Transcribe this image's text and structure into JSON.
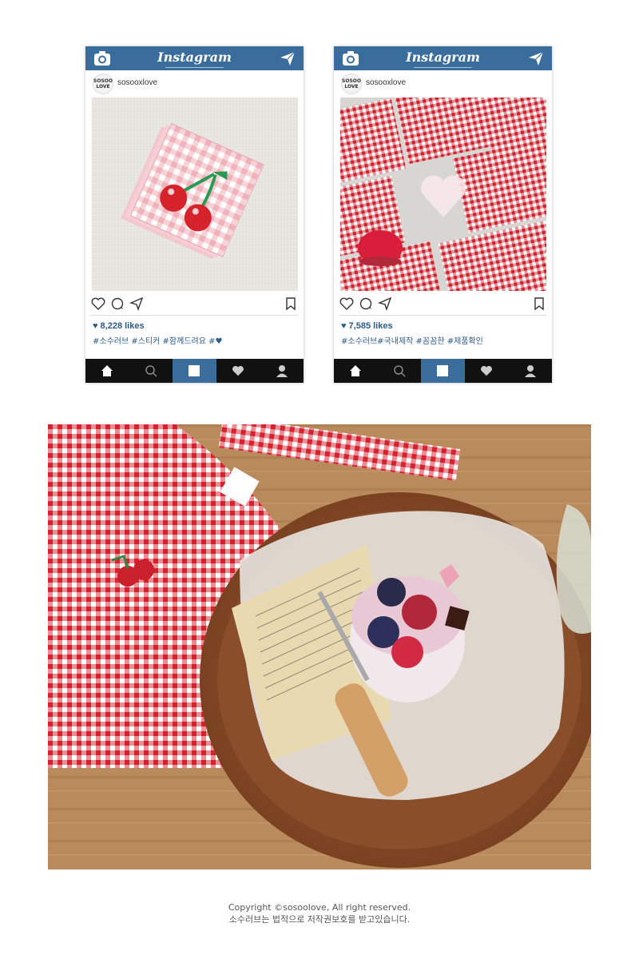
{
  "posts": [
    {
      "app_title": "Instagram",
      "avatar_text": "SOSOO LOVE",
      "username": "sosooxlove",
      "likes": "8,228 likes",
      "tags": "#소수러브  #스티커 #함께드려요 #♥"
    },
    {
      "app_title": "Instagram",
      "avatar_text": "SOSOO LOVE",
      "username": "sosooxlove",
      "likes": "7,585 likes",
      "tags": "#소수러브#국내제작  #꼼꼼한  #제품확인"
    }
  ],
  "footer": {
    "line1": "Copyright ©sosoolove, All right reserved.",
    "line2": "소수러브는 법적으로 저작권보호를 받고있습니다."
  },
  "colors": {
    "instagram_bar": "#3b6d9c",
    "nav_bar": "#111111",
    "gingham_red": "#d9303b",
    "pink_gingham": "#f2b8bf"
  }
}
